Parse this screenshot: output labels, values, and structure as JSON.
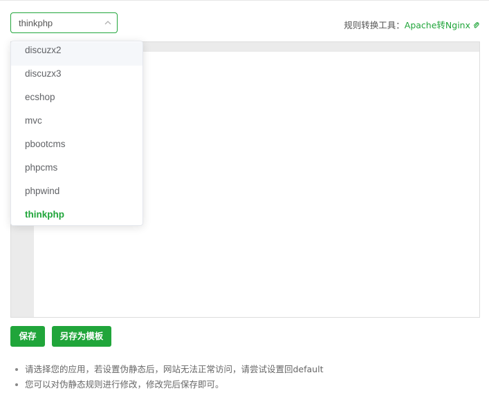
{
  "select": {
    "value": "thinkphp"
  },
  "tool": {
    "label": "规则转换工具：",
    "link": "Apache转Nginx"
  },
  "dropdown": {
    "options": [
      "discuzx2",
      "discuzx3",
      "ecshop",
      "mvc",
      "pbootcms",
      "phpcms",
      "phpwind",
      "thinkphp"
    ],
    "hovered": "discuzx2",
    "selected": "thinkphp"
  },
  "buttons": {
    "save": "保存",
    "save_template": "另存为模板"
  },
  "tips": [
    "请选择您的应用，若设置伪静态后，网站无法正常访问，请尝试设置回default",
    "您可以对伪静态规则进行修改，修改完后保存即可。"
  ],
  "colors": {
    "accent": "#20a53a"
  }
}
